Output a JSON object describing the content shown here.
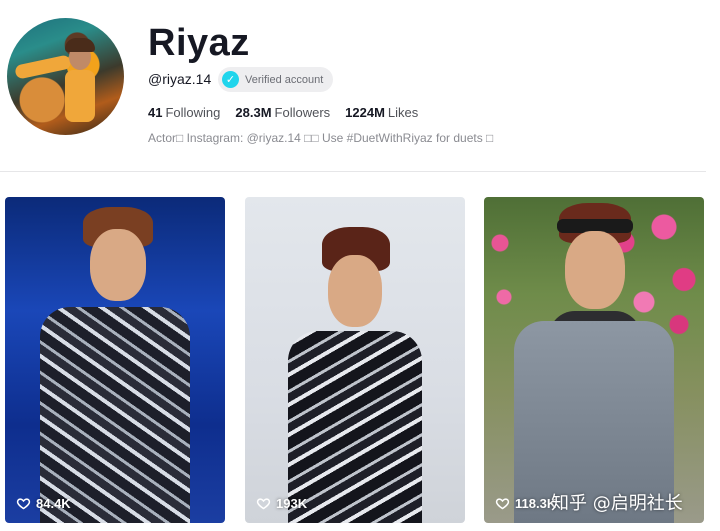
{
  "profile": {
    "name": "Riyaz",
    "handle": "@riyaz.14",
    "verified_label": "Verified account",
    "stats": {
      "following_count": "41",
      "following_label": "Following",
      "followers_count": "28.3M",
      "followers_label": "Followers",
      "likes_count": "1224M",
      "likes_label": "Likes"
    },
    "bio": "Actor□ Instagram: @riyaz.14 □□ Use #DuetWithRiyaz for duets □"
  },
  "videos": [
    {
      "likes": "84.4K",
      "icon": "heart-outline-icon"
    },
    {
      "likes": "193K",
      "icon": "heart-outline-icon"
    },
    {
      "likes": "118.3K",
      "icon": "heart-outline-icon"
    }
  ],
  "watermark": "知乎 @启明社长",
  "colors": {
    "verified_badge": "#20d5ec",
    "text_primary": "#161823",
    "text_secondary": "#8a8b91"
  }
}
